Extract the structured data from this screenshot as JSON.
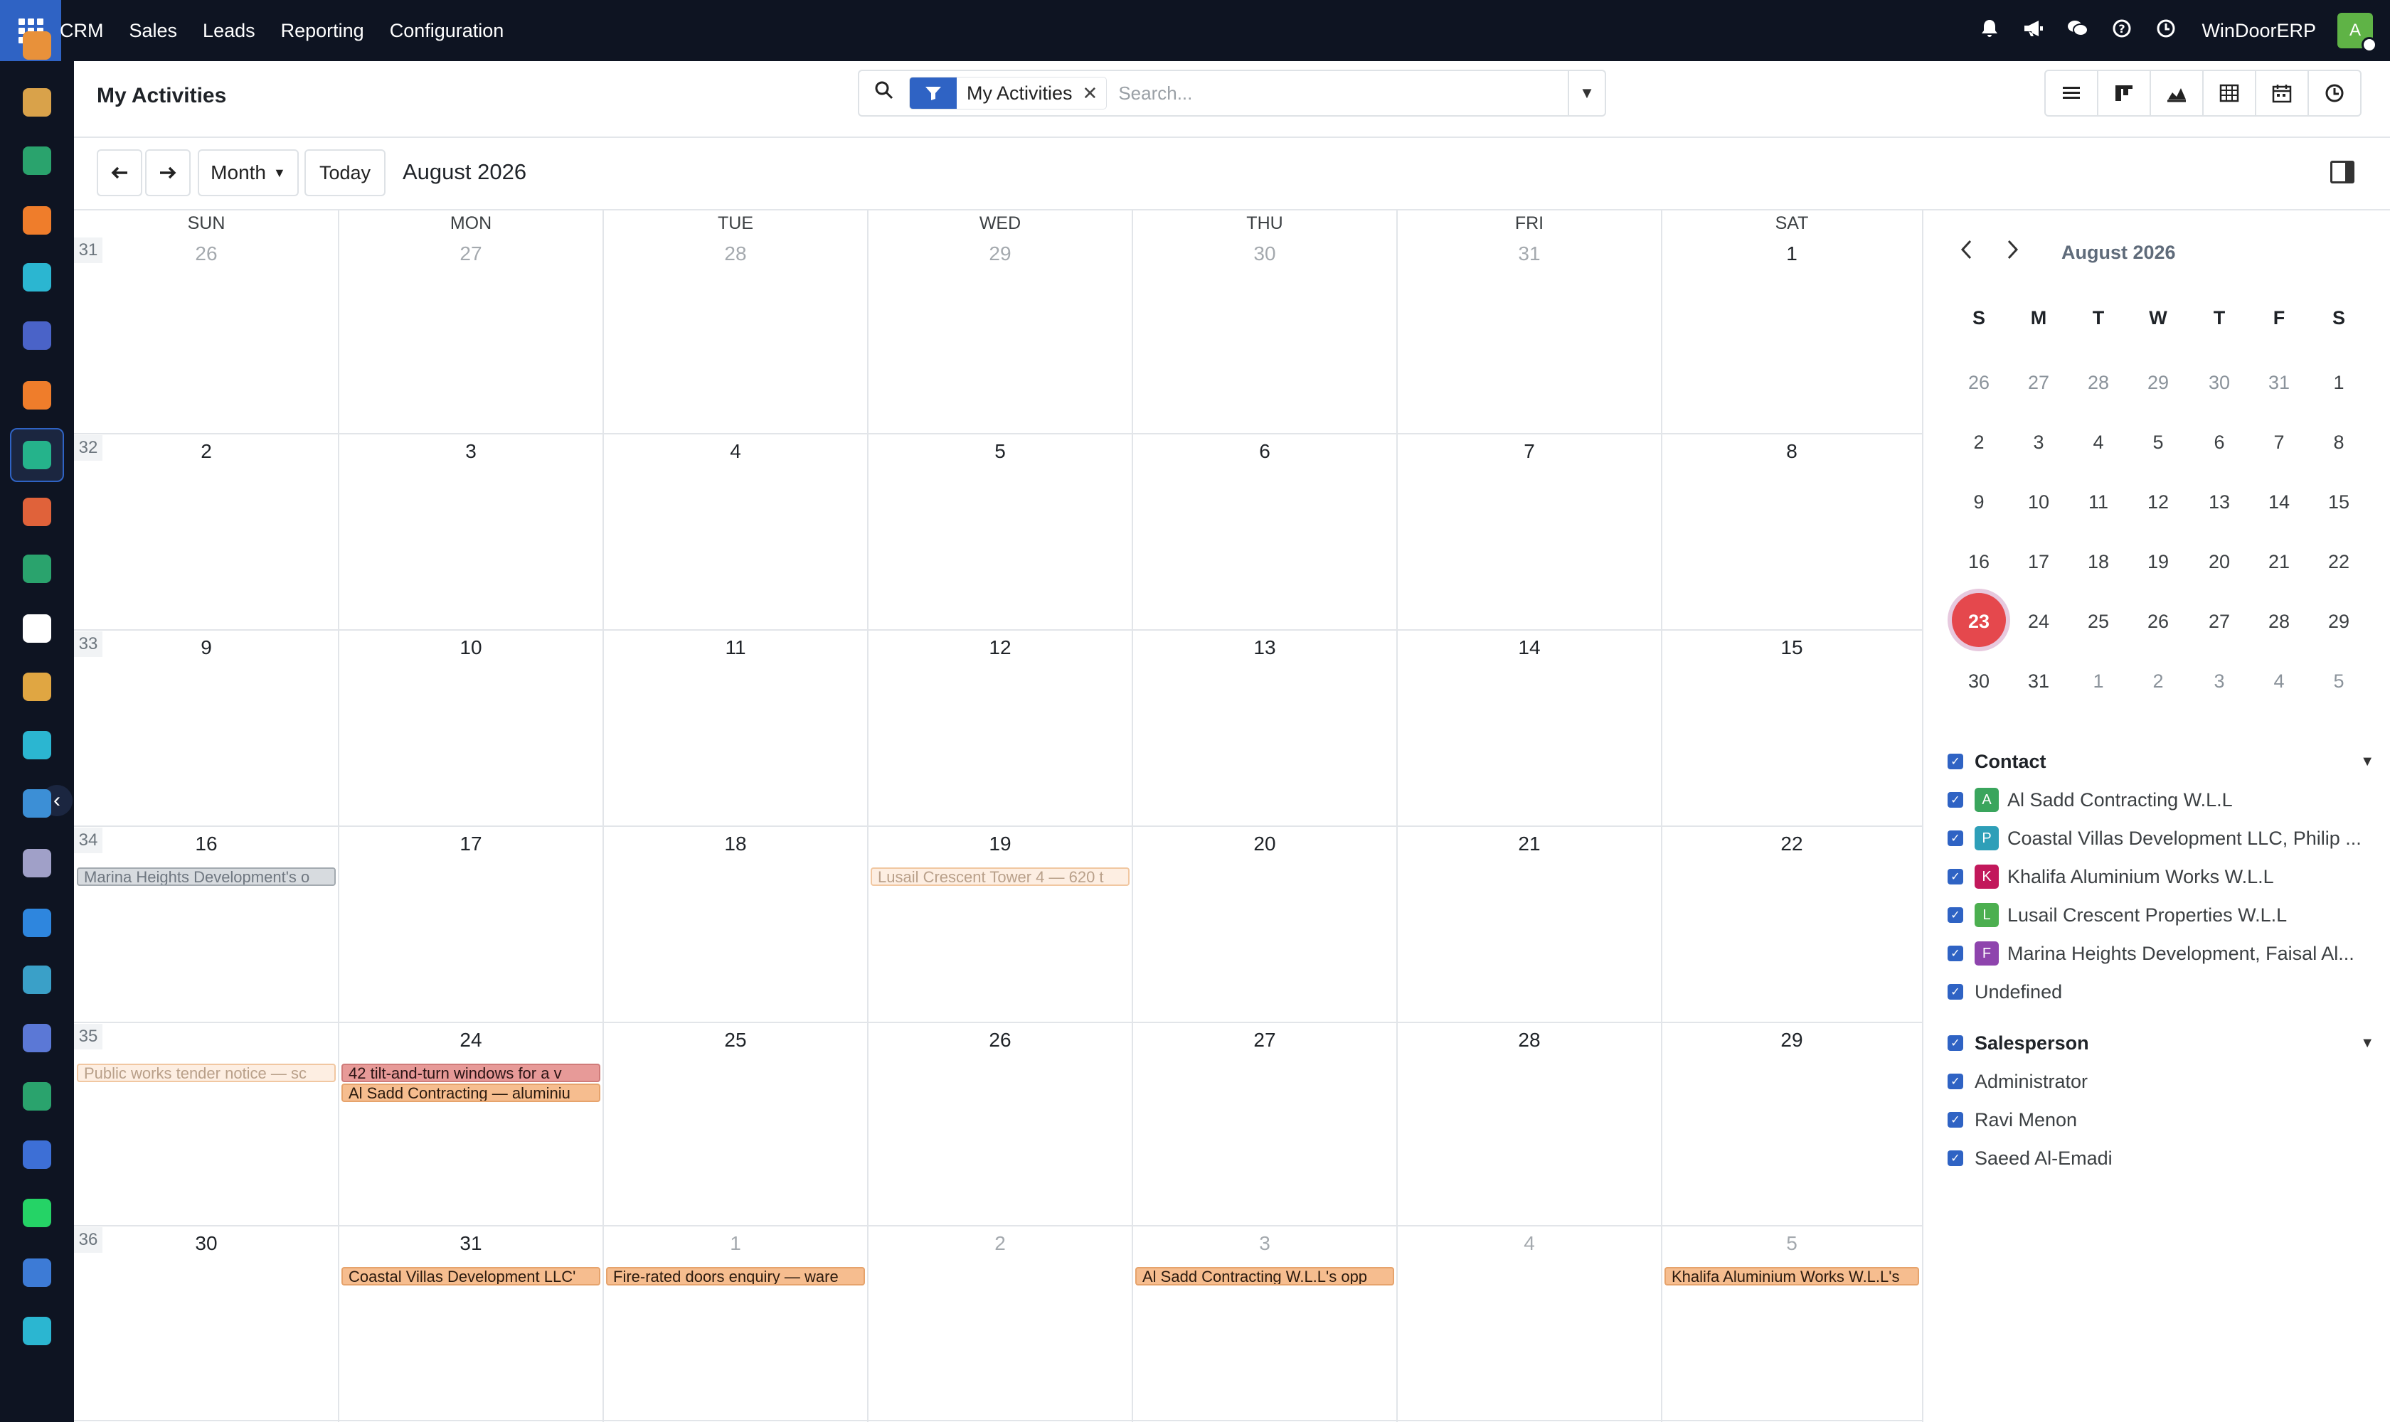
{
  "topbar": {
    "menu": [
      "CRM",
      "Sales",
      "Leads",
      "Reporting",
      "Configuration"
    ],
    "icons": [
      "bell-icon",
      "megaphone-icon",
      "chat-icon",
      "help-icon",
      "clock-icon"
    ],
    "company": "WinDoorERP",
    "avatar_letter": "A"
  },
  "rail": {
    "apps": [
      "crm-app-icon",
      "contacts-app-icon",
      "sales-app-icon",
      "discuss-app-icon",
      "website-app-icon",
      "email-marketing-app-icon",
      "livechat-app-icon",
      "activities-app-icon",
      "reporting-app-icon",
      "employees-app-icon",
      "inventory-app-icon",
      "project-app-icon",
      "tasks-app-icon",
      "knowledge-app-icon",
      "purchase-app-icon",
      "invoicing-app-icon",
      "team-app-icon",
      "calendar-app-icon",
      "sign-app-icon",
      "dashboards-app-icon",
      "whatsapp-app-icon",
      "timesheet-app-icon",
      "studio-app-icon"
    ]
  },
  "control": {
    "title": "My Activities",
    "facet": "My Activities",
    "search_placeholder": "Search...",
    "scale": "Month",
    "today": "Today",
    "period": "August 2026"
  },
  "calendar": {
    "day_headers": [
      "SUN",
      "MON",
      "TUE",
      "WED",
      "THU",
      "FRI",
      "SAT"
    ],
    "weeks": [
      {
        "num": "31",
        "days": [
          {
            "d": "26",
            "m": true
          },
          {
            "d": "27",
            "m": true
          },
          {
            "d": "28",
            "m": true
          },
          {
            "d": "29",
            "m": true
          },
          {
            "d": "30",
            "m": true
          },
          {
            "d": "31",
            "m": true
          },
          {
            "d": "1",
            "m": false
          }
        ]
      },
      {
        "num": "32",
        "days": [
          {
            "d": "2"
          },
          {
            "d": "3"
          },
          {
            "d": "4"
          },
          {
            "d": "5"
          },
          {
            "d": "6"
          },
          {
            "d": "7"
          },
          {
            "d": "8"
          }
        ]
      },
      {
        "num": "33",
        "days": [
          {
            "d": "9"
          },
          {
            "d": "10"
          },
          {
            "d": "11"
          },
          {
            "d": "12"
          },
          {
            "d": "13"
          },
          {
            "d": "14"
          },
          {
            "d": "15"
          }
        ]
      },
      {
        "num": "34",
        "days": [
          {
            "d": "16"
          },
          {
            "d": "17"
          },
          {
            "d": "18"
          },
          {
            "d": "19"
          },
          {
            "d": "20"
          },
          {
            "d": "21"
          },
          {
            "d": "22"
          }
        ]
      },
      {
        "num": "35",
        "days": [
          {
            "d": "23",
            "today": true
          },
          {
            "d": "24"
          },
          {
            "d": "25"
          },
          {
            "d": "26"
          },
          {
            "d": "27"
          },
          {
            "d": "28"
          },
          {
            "d": "29"
          }
        ]
      },
      {
        "num": "36",
        "days": [
          {
            "d": "30"
          },
          {
            "d": "31"
          },
          {
            "d": "1",
            "m": true
          },
          {
            "d": "2",
            "m": true
          },
          {
            "d": "3",
            "m": true
          },
          {
            "d": "4",
            "m": true
          },
          {
            "d": "5",
            "m": true
          }
        ]
      }
    ],
    "events": [
      {
        "week": 3,
        "day": 0,
        "slot": 0,
        "style": "grey",
        "text": "Marina Heights Development's o"
      },
      {
        "week": 3,
        "day": 3,
        "slot": 0,
        "style": "peach-faded",
        "text": "Lusail Crescent Tower 4 — 620 t"
      },
      {
        "week": 4,
        "day": 0,
        "slot": 0,
        "style": "peach-faded",
        "text": "Public works tender notice — sc"
      },
      {
        "week": 4,
        "day": 1,
        "slot": 0,
        "style": "rose",
        "text": "42 tilt-and-turn windows for a v"
      },
      {
        "week": 4,
        "day": 1,
        "slot": 1,
        "style": "peach",
        "text": "Al Sadd Contracting — aluminiu"
      },
      {
        "week": 5,
        "day": 1,
        "slot": 0,
        "style": "peach",
        "text": "Coastal Villas Development LLC'"
      },
      {
        "week": 5,
        "day": 2,
        "slot": 0,
        "style": "peach",
        "text": "Fire-rated doors enquiry — ware"
      },
      {
        "week": 5,
        "day": 4,
        "slot": 0,
        "style": "peach",
        "text": "Al Sadd Contracting W.L.L's opp"
      },
      {
        "week": 5,
        "day": 6,
        "slot": 0,
        "style": "peach",
        "text": "Khalifa Aluminium Works W.L.L's"
      }
    ]
  },
  "mini_calendar": {
    "title": "August 2026",
    "dow": [
      "S",
      "M",
      "T",
      "W",
      "T",
      "F",
      "S"
    ],
    "weeks": [
      [
        {
          "d": "26",
          "m": true
        },
        {
          "d": "27",
          "m": true
        },
        {
          "d": "28",
          "m": true
        },
        {
          "d": "29",
          "m": true
        },
        {
          "d": "30",
          "m": true
        },
        {
          "d": "31",
          "m": true
        },
        {
          "d": "1"
        }
      ],
      [
        {
          "d": "2"
        },
        {
          "d": "3"
        },
        {
          "d": "4"
        },
        {
          "d": "5"
        },
        {
          "d": "6"
        },
        {
          "d": "7"
        },
        {
          "d": "8"
        }
      ],
      [
        {
          "d": "9"
        },
        {
          "d": "10"
        },
        {
          "d": "11"
        },
        {
          "d": "12"
        },
        {
          "d": "13"
        },
        {
          "d": "14"
        },
        {
          "d": "15"
        }
      ],
      [
        {
          "d": "16"
        },
        {
          "d": "17"
        },
        {
          "d": "18"
        },
        {
          "d": "19"
        },
        {
          "d": "20"
        },
        {
          "d": "21"
        },
        {
          "d": "22"
        }
      ],
      [
        {
          "d": "23",
          "sel": true
        },
        {
          "d": "24"
        },
        {
          "d": "25"
        },
        {
          "d": "26"
        },
        {
          "d": "27"
        },
        {
          "d": "28"
        },
        {
          "d": "29"
        }
      ],
      [
        {
          "d": "30"
        },
        {
          "d": "31"
        },
        {
          "d": "1",
          "m": true
        },
        {
          "d": "2",
          "m": true
        },
        {
          "d": "3",
          "m": true
        },
        {
          "d": "4",
          "m": true
        },
        {
          "d": "5",
          "m": true
        }
      ]
    ]
  },
  "filters": {
    "contact": {
      "title": "Contact",
      "items": [
        {
          "letter": "A",
          "color": "#3aa55d",
          "label": "Al Sadd Contracting W.L.L"
        },
        {
          "letter": "P",
          "color": "#2e9fb8",
          "label": "Coastal Villas Development LLC, Philip ..."
        },
        {
          "letter": "K",
          "color": "#c2185b",
          "label": "Khalifa Aluminium Works W.L.L"
        },
        {
          "letter": "L",
          "color": "#4caf50",
          "label": "Lusail Crescent Properties W.L.L"
        },
        {
          "letter": "F",
          "color": "#8e44ad",
          "label": "Marina Heights Development, Faisal Al..."
        },
        {
          "letter": "",
          "color": "",
          "label": "Undefined"
        }
      ]
    },
    "salesperson": {
      "title": "Salesperson",
      "items": [
        "Administrator",
        "Ravi Menon",
        "Saeed Al-Emadi"
      ]
    }
  }
}
